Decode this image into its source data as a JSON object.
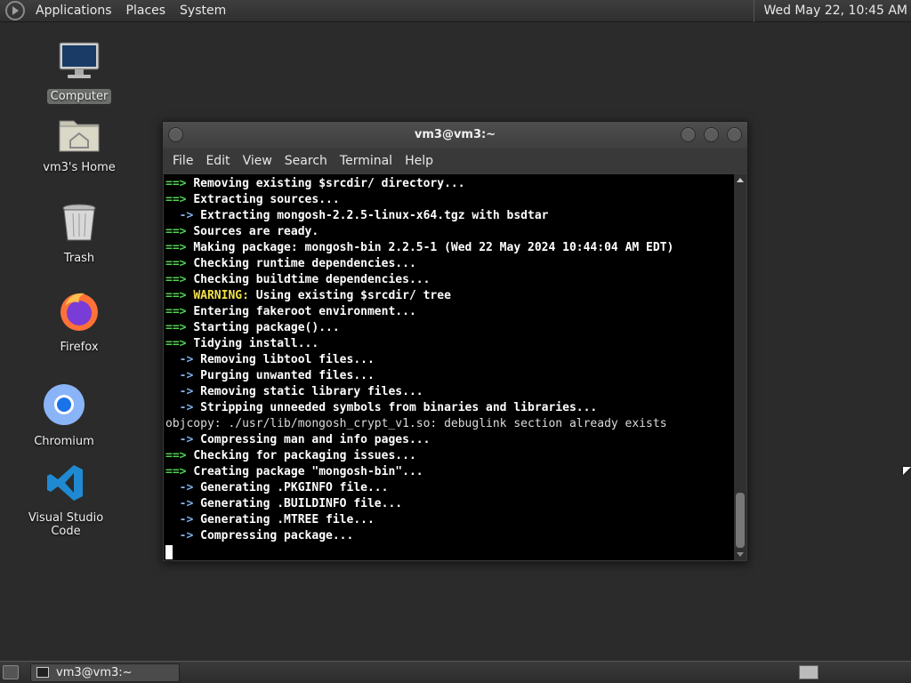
{
  "top_panel": {
    "menus": [
      "Applications",
      "Places",
      "System"
    ],
    "clock": "Wed May 22, 10:45 AM"
  },
  "desktop_icons": [
    {
      "label": "Computer",
      "icon": "computer-icon"
    },
    {
      "label": "vm3's Home",
      "icon": "home-folder-icon"
    },
    {
      "label": "Trash",
      "icon": "trash-icon"
    },
    {
      "label": "Firefox",
      "icon": "firefox-icon"
    },
    {
      "label": "Chromium",
      "icon": "chromium-icon"
    },
    {
      "label": "Visual Studio Code",
      "icon": "vscode-icon"
    }
  ],
  "window": {
    "title": "vm3@vm3:~",
    "menu": [
      "File",
      "Edit",
      "View",
      "Search",
      "Terminal",
      "Help"
    ]
  },
  "terminal_lines": [
    {
      "kind": "main",
      "text": "Removing existing $srcdir/ directory..."
    },
    {
      "kind": "main",
      "text": "Extracting sources..."
    },
    {
      "kind": "sub",
      "text": "Extracting mongosh-2.2.5-linux-x64.tgz with bsdtar"
    },
    {
      "kind": "main",
      "text": "Sources are ready."
    },
    {
      "kind": "main",
      "text": "Making package: mongosh-bin 2.2.5-1 (Wed 22 May 2024 10:44:04 AM EDT)"
    },
    {
      "kind": "main",
      "text": "Checking runtime dependencies..."
    },
    {
      "kind": "main",
      "text": "Checking buildtime dependencies..."
    },
    {
      "kind": "warn",
      "label": "WARNING:",
      "text": " Using existing $srcdir/ tree"
    },
    {
      "kind": "main",
      "text": "Entering fakeroot environment..."
    },
    {
      "kind": "main",
      "text": "Starting package()..."
    },
    {
      "kind": "main",
      "text": "Tidying install..."
    },
    {
      "kind": "sub",
      "text": "Removing libtool files..."
    },
    {
      "kind": "sub",
      "text": "Purging unwanted files..."
    },
    {
      "kind": "sub",
      "text": "Removing static library files..."
    },
    {
      "kind": "sub",
      "text": "Stripping unneeded symbols from binaries and libraries..."
    },
    {
      "kind": "plain",
      "text": "objcopy: ./usr/lib/mongosh_crypt_v1.so: debuglink section already exists"
    },
    {
      "kind": "sub",
      "text": "Compressing man and info pages..."
    },
    {
      "kind": "main",
      "text": "Checking for packaging issues..."
    },
    {
      "kind": "main",
      "text": "Creating package \"mongosh-bin\"..."
    },
    {
      "kind": "sub",
      "text": "Generating .PKGINFO file..."
    },
    {
      "kind": "sub",
      "text": "Generating .BUILDINFO file..."
    },
    {
      "kind": "sub",
      "text": "Generating .MTREE file..."
    },
    {
      "kind": "sub",
      "text": "Compressing package..."
    }
  ],
  "taskbar": {
    "task_label": "vm3@vm3:~"
  }
}
